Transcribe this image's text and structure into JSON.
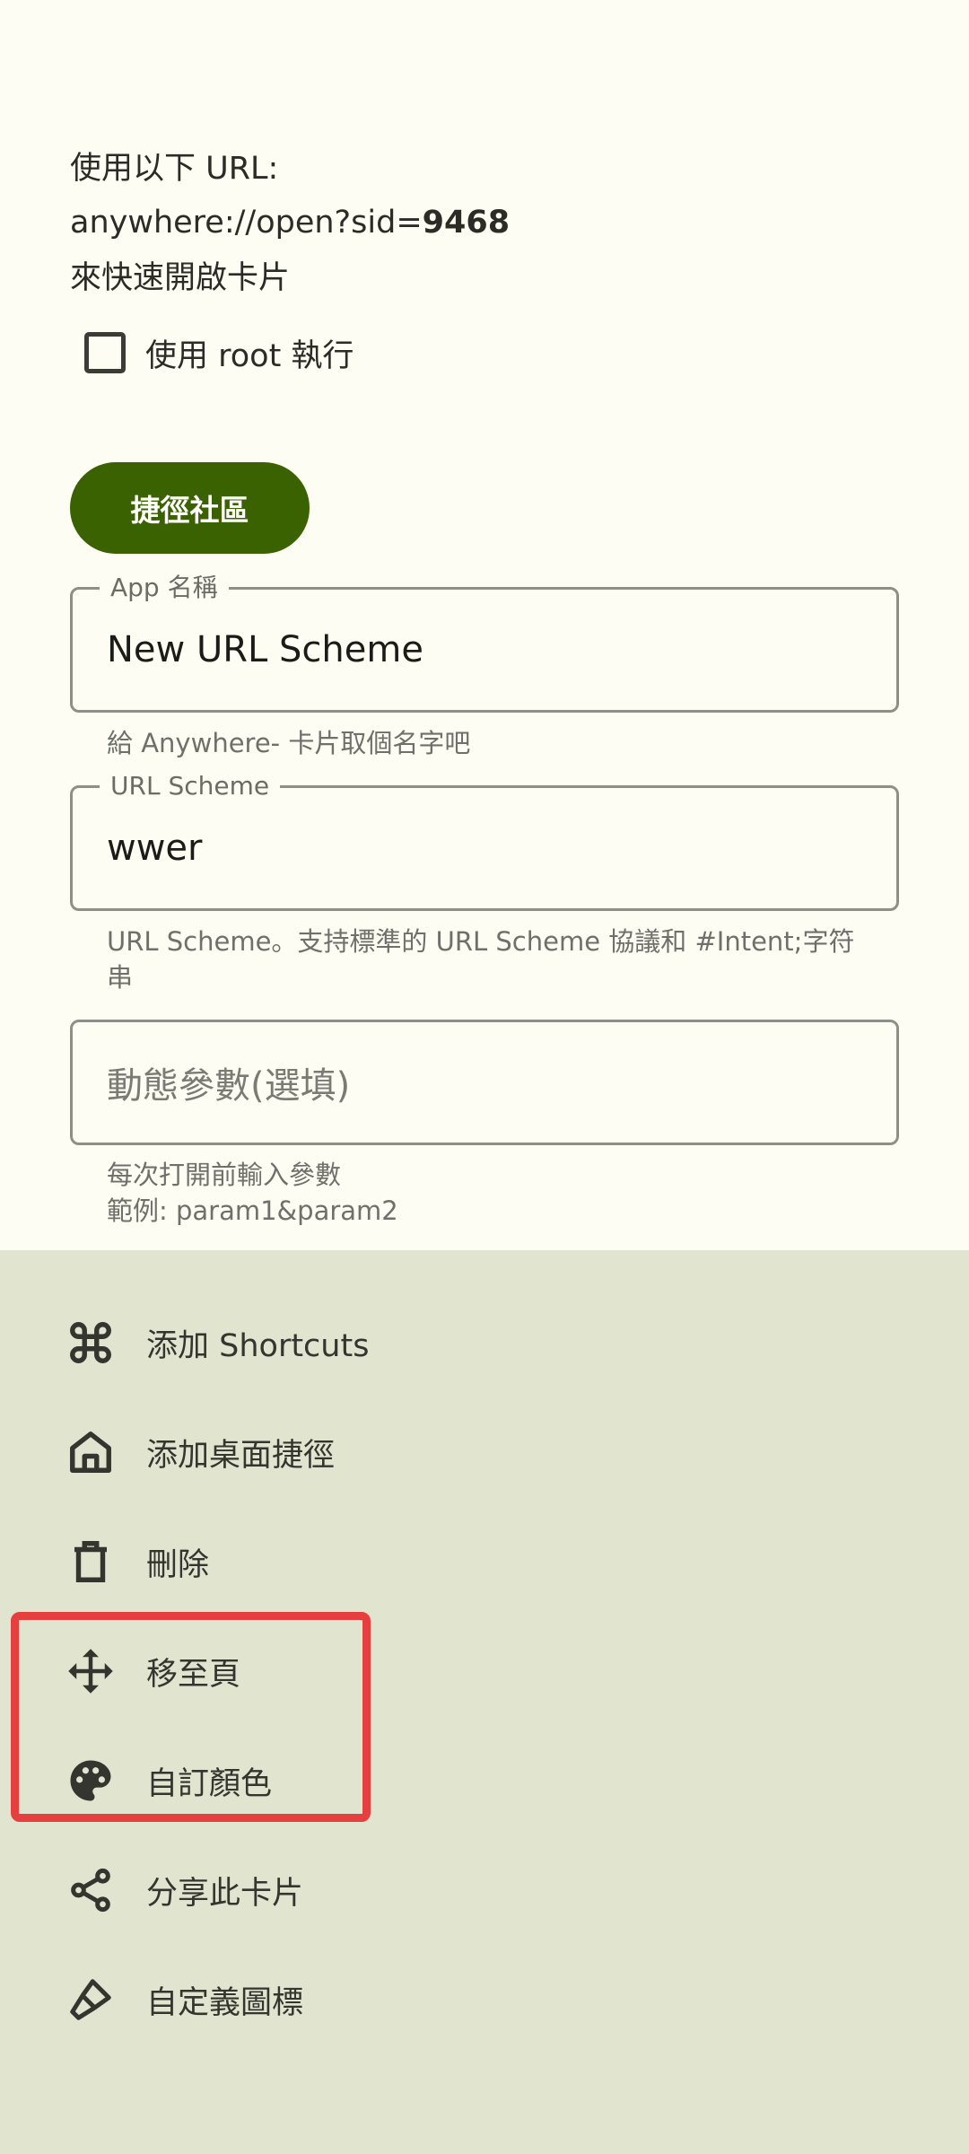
{
  "info": {
    "line1": "使用以下 URL:",
    "url_prefix": "anywhere://open?sid=",
    "url_sid": "9468",
    "line3": "來快速開啟卡片"
  },
  "root_checkbox": {
    "label": "使用 root 執行",
    "checked": false
  },
  "community_button": "捷徑社區",
  "app_name_field": {
    "label": "App 名稱",
    "value": "New URL Scheme",
    "helper": "給 Anywhere- 卡片取個名字吧"
  },
  "url_scheme_field": {
    "label": "URL Scheme",
    "value": "wwer",
    "helper": "URL Scheme。支持標準的 URL Scheme 協議和 #Intent;字符串"
  },
  "dynamic_param_field": {
    "placeholder": "動態參數(選填)",
    "helper_line1": "每次打開前輸入參數",
    "helper_line2": "範例: param1&param2"
  },
  "menu": [
    {
      "icon": "command-icon",
      "label": "添加 Shortcuts"
    },
    {
      "icon": "home-icon",
      "label": "添加桌面捷徑"
    },
    {
      "icon": "trash-icon",
      "label": "刪除"
    },
    {
      "icon": "move-icon",
      "label": "移至頁"
    },
    {
      "icon": "palette-icon",
      "label": "自訂顏色"
    },
    {
      "icon": "share-icon",
      "label": "分享此卡片"
    },
    {
      "icon": "brush-icon",
      "label": "自定義圖標"
    }
  ],
  "colors": {
    "background": "#fdfdf4",
    "sheet": "#e1e5d0",
    "primary_button": "#3b6200",
    "highlight": "#e53f3f"
  }
}
